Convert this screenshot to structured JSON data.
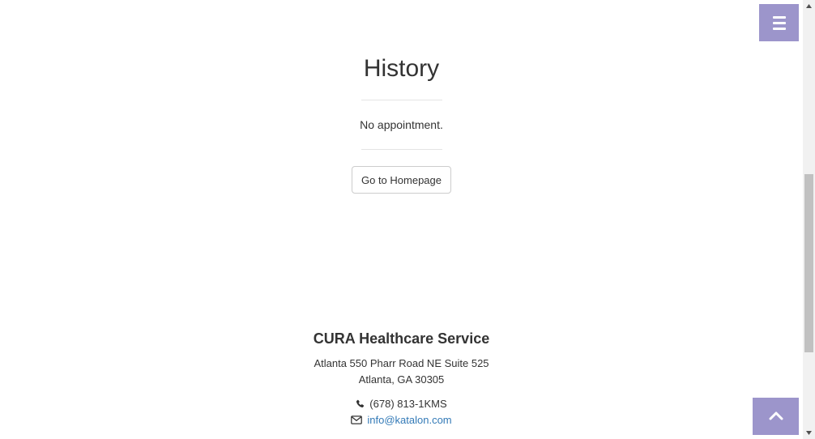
{
  "history": {
    "title": "History",
    "empty_message": "No appointment.",
    "home_button_label": "Go to Homepage"
  },
  "footer": {
    "company": "CURA Healthcare Service",
    "address_line1": "Atlanta 550 Pharr Road NE Suite 525",
    "address_line2": "Atlanta, GA 30305",
    "phone": "(678) 813-1KMS",
    "email": "info@katalon.com"
  },
  "icons": {
    "menu": "bars-icon",
    "phone": "phone-icon",
    "email": "envelope-icon",
    "to_top": "chevron-up-icon"
  },
  "colors": {
    "accent": "#9c95cb",
    "link": "#337ab7",
    "text": "#333333"
  }
}
